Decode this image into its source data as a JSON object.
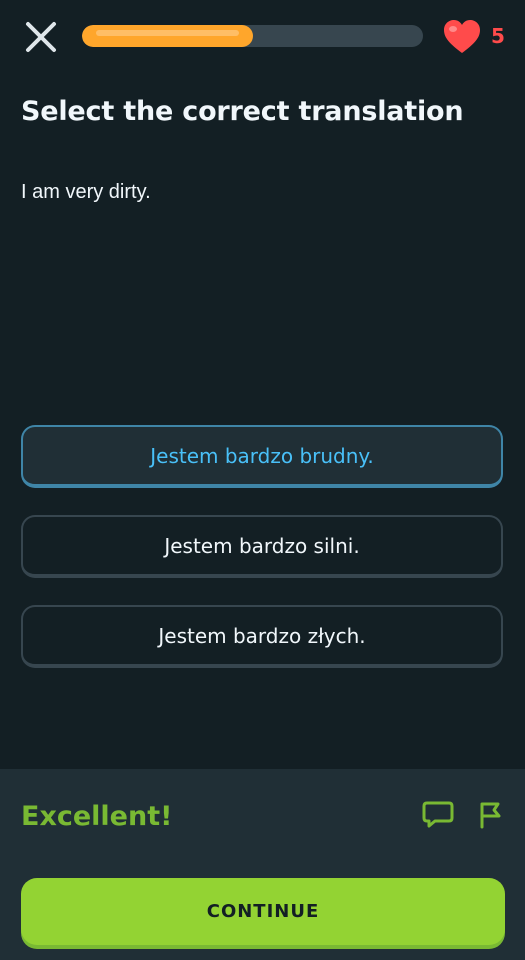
{
  "header": {
    "close_icon": "close-icon",
    "progress_fraction": 0.5,
    "hearts_icon": "heart-icon",
    "hearts_count": "5",
    "progress_color": "#ffa62b",
    "heart_color": "#ff4b4b"
  },
  "exercise": {
    "title": "Select the correct translation",
    "prompt": "I am very dirty.",
    "choices": [
      {
        "label": "Jestem bardzo brudny.",
        "selected": true
      },
      {
        "label": "Jestem bardzo silni.",
        "selected": false
      },
      {
        "label": "Jestem bardzo złych.",
        "selected": false
      }
    ]
  },
  "feedback": {
    "message": "Excellent!",
    "discuss_icon": "comment-icon",
    "report_icon": "flag-icon",
    "continue_label": "CONTINUE",
    "success_color": "#79b933",
    "button_color": "#93d333"
  }
}
